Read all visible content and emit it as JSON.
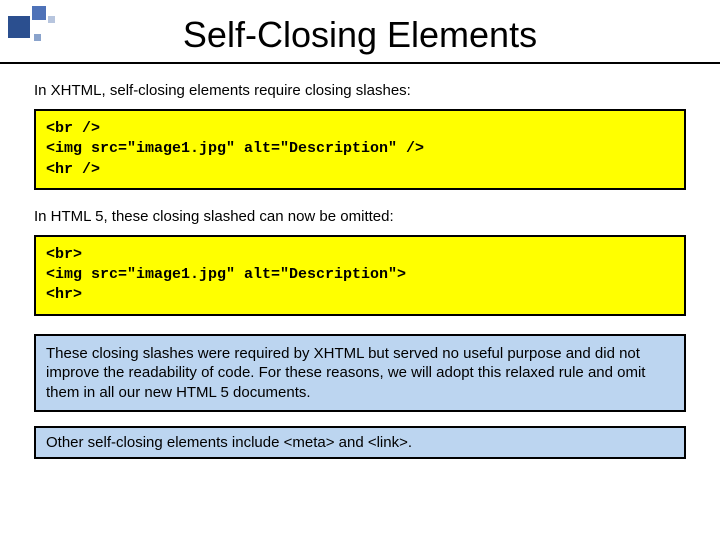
{
  "slide": {
    "title": "Self-Closing Elements",
    "intro1": "In XHTML, self-closing elements require closing slashes:",
    "code1": "<br />\n<img src=\"image1.jpg\" alt=\"Description\" />\n<hr />",
    "intro2": "In HTML 5, these closing slashed can now be omitted:",
    "code2": "<br>\n<img src=\"image1.jpg\" alt=\"Description\">\n<hr>",
    "note1": "These closing slashes were required by XHTML but served no useful purpose and did not improve the readability of code.  For these reasons, we will adopt this relaxed rule and omit them in all our new HTML 5 documents.",
    "note2": "Other self-closing elements include <meta> and <link>."
  }
}
